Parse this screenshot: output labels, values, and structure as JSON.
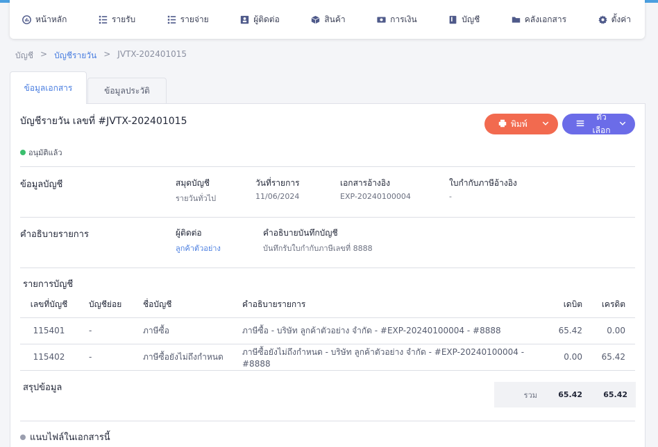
{
  "nav": [
    {
      "key": "home",
      "label": "หน้าหลัก",
      "icon": "dashboard-icon"
    },
    {
      "key": "income",
      "label": "รายรับ",
      "icon": "list-icon"
    },
    {
      "key": "expense",
      "label": "รายจ่าย",
      "icon": "list-icon"
    },
    {
      "key": "contacts",
      "label": "ผู้ติดต่อ",
      "icon": "contacts-icon"
    },
    {
      "key": "products",
      "label": "สินค้า",
      "icon": "box-icon"
    },
    {
      "key": "finance",
      "label": "การเงิน",
      "icon": "money-icon"
    },
    {
      "key": "accounts",
      "label": "บัญชี",
      "icon": "book-icon"
    },
    {
      "key": "docs",
      "label": "คลังเอกสาร",
      "icon": "folder-icon"
    },
    {
      "key": "settings",
      "label": "ตั้งค่า",
      "icon": "gear-icon"
    }
  ],
  "breadcrumb": {
    "root": "บัญชี",
    "sep": ">",
    "section": "บัญชีรายวัน",
    "current": "JVTX-202401015"
  },
  "tabs": {
    "doc_info": "ข้อมูลเอกสาร",
    "history": "ข้อมูลประวัติ"
  },
  "document": {
    "title": "บัญชีรายวัน เลขที่ #JVTX-202401015",
    "status": "อนุมัติแล้ว",
    "status_color": "#3bbf6e",
    "print_label": "พิมพ์",
    "options_label": "ตัวเลือก"
  },
  "account_info": {
    "title": "ข้อมูลบัญชี",
    "journal_label": "สมุดบัญชี",
    "journal_value": "รายวันทั่วไป",
    "date_label": "วันที่รายการ",
    "date_value": "11/06/2024",
    "ref_label": "เอกสารอ้างอิง",
    "ref_value": "EXP-20240100004",
    "tax_label": "ใบกำกับภาษีอ้างอิง",
    "tax_value": "-"
  },
  "description": {
    "title": "คำอธิบายรายการ",
    "contact_label": "ผู้ติดต่อ",
    "contact_value": "ลูกค้าตัวอย่าง",
    "note_label": "คำอธิบายบันทึกบัญชี",
    "note_value": "บันทึกรับใบกำกับภาษีเลขที่ 8888"
  },
  "ledger": {
    "title": "รายการบัญชี",
    "headers": {
      "code": "เลขที่บัญชี",
      "sub": "บัญชีย่อย",
      "name": "ชื่อบัญชี",
      "desc": "คำอธิบายรายการ",
      "debit": "เดบิต",
      "credit": "เครดิต"
    },
    "rows": [
      {
        "code": "115401",
        "sub": "-",
        "name": "ภาษีซื้อ",
        "desc": "ภาษีซื้อ - บริษัท ลูกค้าตัวอย่าง จำกัด - #EXP-20240100004 - #8888",
        "debit": "65.42",
        "credit": "0.00"
      },
      {
        "code": "115402",
        "sub": "-",
        "name": "ภาษีซื้อยังไม่ถึงกำหนด",
        "desc": "ภาษีซื้อยังไม่ถึงกำหนด - บริษัท ลูกค้าตัวอย่าง จำกัด - #EXP-20240100004 - #8888",
        "debit": "0.00",
        "credit": "65.42"
      }
    ]
  },
  "summary": {
    "title": "สรุปข้อมูล",
    "total_label": "รวม",
    "total_debit": "65.42",
    "total_credit": "65.42"
  },
  "attachments": {
    "title": "แนบไฟล์ในเอกสารนี้"
  }
}
